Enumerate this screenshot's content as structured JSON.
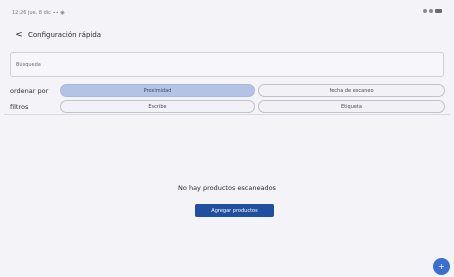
{
  "status_bar": {
    "left_text": "12:26  jue, 8 dic  ∙∙  ◉",
    "right_text": "▾ ▿"
  },
  "app_bar": {
    "back_icon": "back-arrow-icon",
    "back_glyph": "<",
    "title": "Configuración rápida"
  },
  "search": {
    "placeholder": "Búsqueda",
    "value": ""
  },
  "sort": {
    "label": "ordenar por",
    "options": [
      "Proximidad",
      "fecha de escaneo"
    ],
    "selected": "Proximidad"
  },
  "filters": {
    "label": "filtros",
    "options": [
      "Escribe",
      "Etiqueta"
    ]
  },
  "empty_state": {
    "message": "No hay productos escaneados",
    "button_label": "Agregar productos"
  },
  "fab": {
    "icon": "add-icon",
    "glyph": "+"
  },
  "colors": {
    "selected_segment": "#b3c3e6",
    "primary_button": "#1f4f9e",
    "fab": "#3a6fd1",
    "background": "#f3f3f8"
  }
}
